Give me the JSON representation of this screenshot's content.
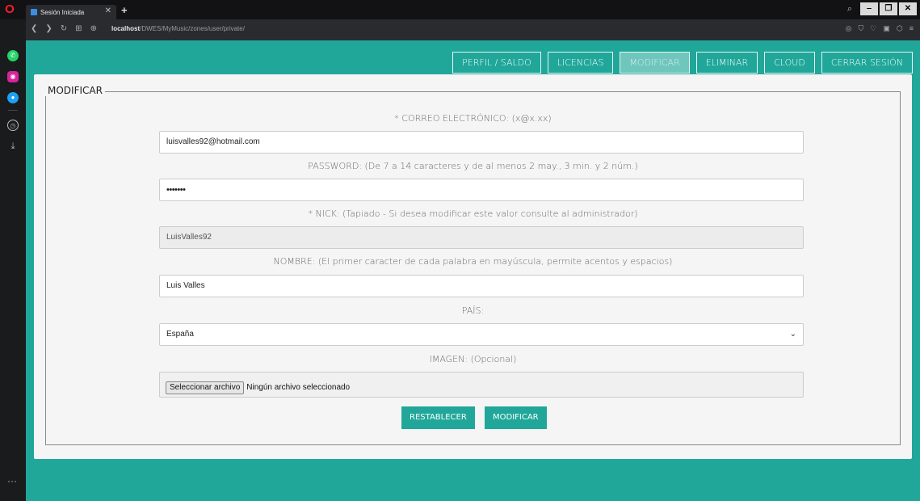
{
  "browser": {
    "tab_title": "Sesión Iniciada",
    "url_host": "localhost",
    "url_path": "/DWES/MyMusic/zones/user/private/"
  },
  "nav": {
    "items": [
      {
        "label": "PERFIL / SALDO",
        "active": false
      },
      {
        "label": "LICENCIAS",
        "active": false
      },
      {
        "label": "MODIFICAR",
        "active": true
      },
      {
        "label": "ELIMINAR",
        "active": false
      },
      {
        "label": "CLOUD",
        "active": false
      },
      {
        "label": "CERRAR SESIÓN",
        "active": false
      }
    ]
  },
  "form": {
    "legend": "MODIFICAR",
    "email": {
      "label": "* CORREO ELECTRÓNICO: (x@x.xx)",
      "value": "luisvalles92@hotmail.com"
    },
    "password": {
      "label": "PASSWORD: (De 7 a 14 caracteres y de al menos 2 may., 3 min. y 2 núm.)",
      "value": "•••••••"
    },
    "nick": {
      "label": "* NICK: (Tapiado - Si desea modificar este valor consulte al administrador)",
      "value": "LuisValles92"
    },
    "nombre": {
      "label": "NOMBRE: (El primer caracter de cada palabra en mayúscula, permite acentos y espacios)",
      "value": "Luis Valles"
    },
    "pais": {
      "label": "PAÍS:",
      "value": "España"
    },
    "imagen": {
      "label": "IMAGEN: (Opcional)",
      "button": "Seleccionar archivo",
      "status": "Ningún archivo seleccionado"
    },
    "reset_label": "RESTABLECER",
    "submit_label": "MODIFICAR"
  },
  "colors": {
    "accent": "#20a79a",
    "accent_active": "#6fc6bd",
    "panel": "#f5f5f5"
  }
}
